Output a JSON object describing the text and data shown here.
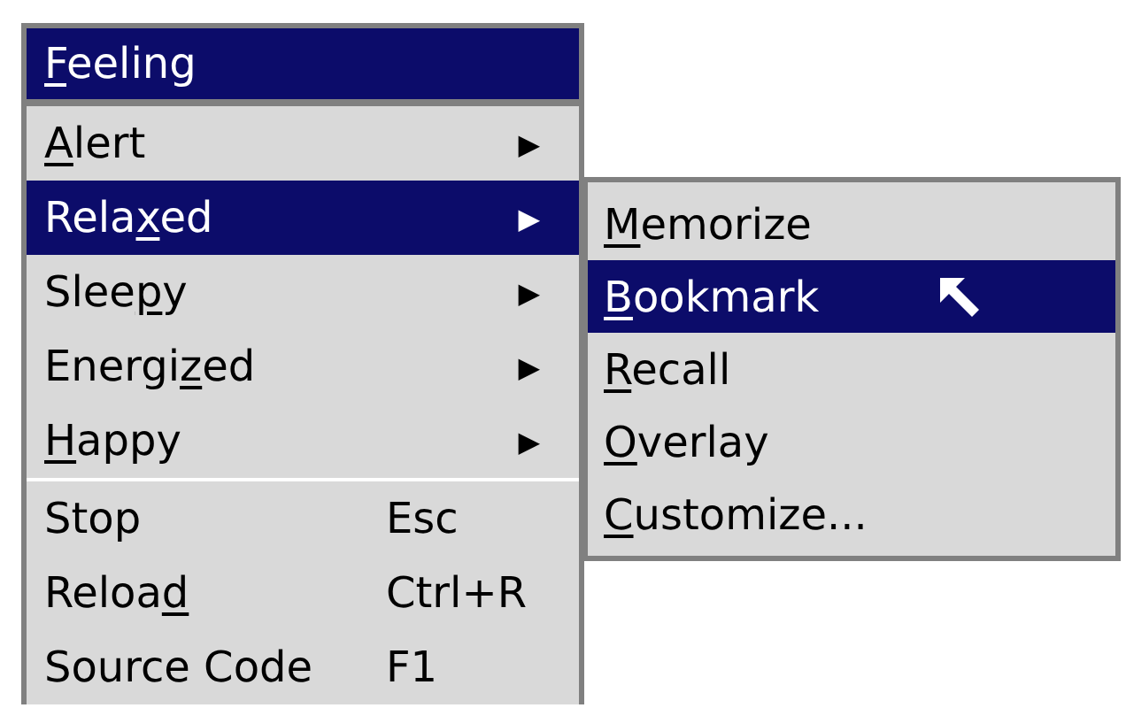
{
  "menu": {
    "title_parts": [
      {
        "text": "F",
        "underline": true
      },
      {
        "text": "eeling"
      }
    ],
    "sections": [
      {
        "items": [
          {
            "kind": "submenu",
            "selected": false,
            "label_parts": [
              {
                "text": "A",
                "underline": true
              },
              {
                "text": "lert"
              }
            ],
            "arrow": "▶"
          },
          {
            "kind": "submenu",
            "selected": true,
            "label_parts": [
              {
                "text": "Rela"
              },
              {
                "text": "x",
                "underline": true
              },
              {
                "text": "ed"
              }
            ],
            "arrow": "▶"
          },
          {
            "kind": "submenu",
            "selected": false,
            "label_parts": [
              {
                "text": "Slee"
              },
              {
                "text": "p",
                "underline": true
              },
              {
                "text": "y"
              }
            ],
            "arrow": "▶"
          },
          {
            "kind": "submenu",
            "selected": false,
            "label_parts": [
              {
                "text": "Energi"
              },
              {
                "text": "z",
                "underline": true
              },
              {
                "text": "ed"
              }
            ],
            "arrow": "▶"
          },
          {
            "kind": "submenu",
            "selected": false,
            "label_parts": [
              {
                "text": "H",
                "underline": true
              },
              {
                "text": "appy"
              }
            ],
            "arrow": "▶"
          }
        ]
      },
      {
        "items": [
          {
            "kind": "command",
            "selected": false,
            "label_parts": [
              {
                "text": "Stop"
              }
            ],
            "shortcut": "Esc"
          },
          {
            "kind": "command",
            "selected": false,
            "label_parts": [
              {
                "text": "Reloa"
              },
              {
                "text": "d",
                "underline": true
              }
            ],
            "shortcut": "Ctrl+R"
          },
          {
            "kind": "command",
            "selected": false,
            "label_parts": [
              {
                "text": "Source Code"
              }
            ],
            "shortcut": "F1"
          }
        ]
      }
    ]
  },
  "submenu": {
    "items": [
      {
        "selected": false,
        "label_parts": [
          {
            "text": "M",
            "underline": true
          },
          {
            "text": "emorize"
          }
        ]
      },
      {
        "selected": true,
        "label_parts": [
          {
            "text": "B",
            "underline": true
          },
          {
            "text": "ookmark"
          }
        ],
        "pointer": true
      },
      {
        "selected": false,
        "label_parts": [
          {
            "text": "R",
            "underline": true
          },
          {
            "text": "ecall"
          }
        ]
      },
      {
        "selected": false,
        "label_parts": [
          {
            "text": "O",
            "underline": true
          },
          {
            "text": "verlay"
          }
        ]
      },
      {
        "selected": false,
        "label_parts": [
          {
            "text": "C",
            "underline": true
          },
          {
            "text": "ustomize..."
          }
        ]
      }
    ]
  }
}
